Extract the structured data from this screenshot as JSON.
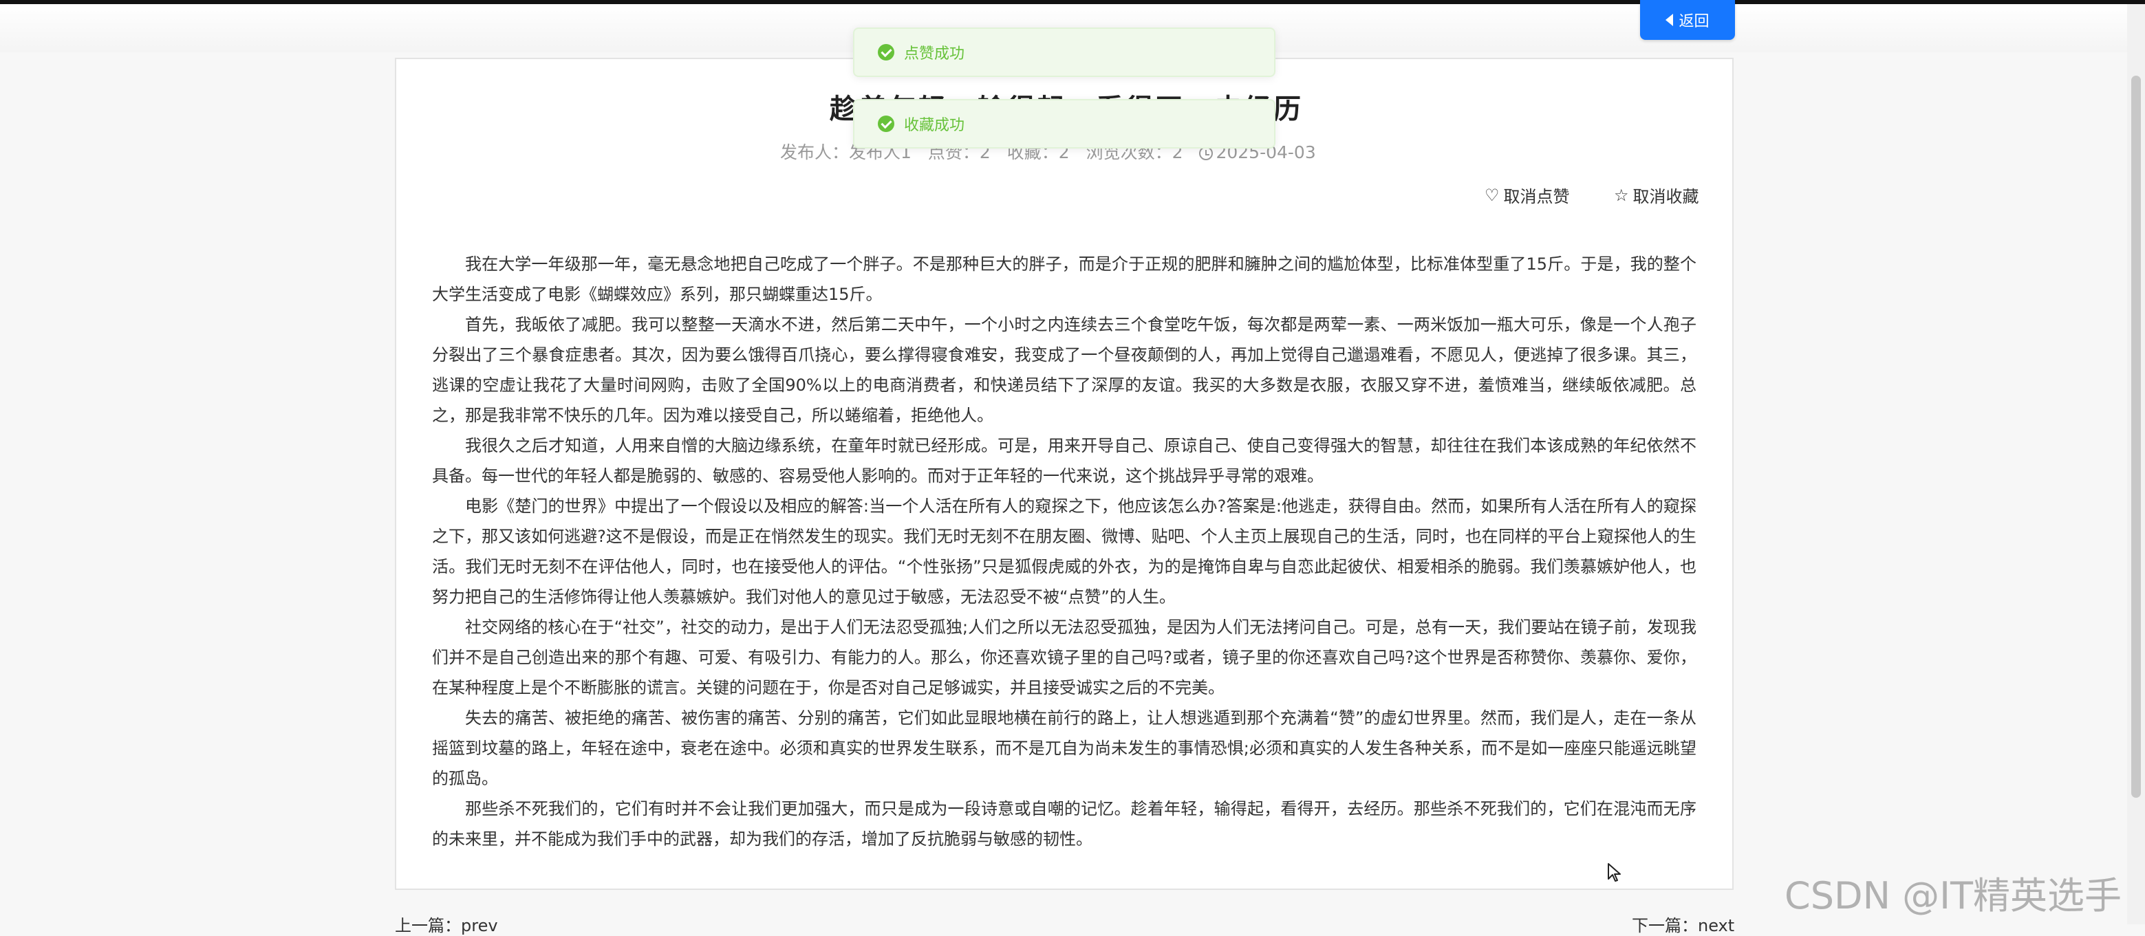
{
  "header": {
    "back_label": "返回"
  },
  "toasts": [
    {
      "text": "点赞成功"
    },
    {
      "text": "收藏成功"
    }
  ],
  "article": {
    "title": "趁着年轻，输得起，看得开，去经历",
    "meta": {
      "publisher": "发布人：发布人1",
      "likes": "点赞：2",
      "favorites": "收藏：2",
      "views": "浏览次数：2",
      "date": "2025-04-03"
    },
    "actions": {
      "unlike": "取消点赞",
      "unfavorite": "取消收藏"
    },
    "paragraphs": [
      "我在大学一年级那一年，毫无悬念地把自己吃成了一个胖子。不是那种巨大的胖子，而是介于正规的肥胖和臃肿之间的尴尬体型，比标准体型重了15斤。于是，我的整个大学生活变成了电影《蝴蝶效应》系列，那只蝴蝶重达15斤。",
      "首先，我皈依了减肥。我可以整整一天滴水不进，然后第二天中午，一个小时之内连续去三个食堂吃午饭，每次都是两荤一素、一两米饭加一瓶大可乐，像是一个人孢子分裂出了三个暴食症患者。其次，因为要么饿得百爪挠心，要么撑得寝食难安，我变成了一个昼夜颠倒的人，再加上觉得自己邋遢难看，不愿见人，便逃掉了很多课。其三，逃课的空虚让我花了大量时间网购，击败了全国90%以上的电商消费者，和快递员结下了深厚的友谊。我买的大多数是衣服，衣服又穿不进，羞愤难当，继续皈依减肥。总之，那是我非常不快乐的几年。因为难以接受自己，所以蜷缩着，拒绝他人。",
      "我很久之后才知道，人用来自憎的大脑边缘系统，在童年时就已经形成。可是，用来开导自己、原谅自己、使自己变得强大的智慧，却往往在我们本该成熟的年纪依然不具备。每一世代的年轻人都是脆弱的、敏感的、容易受他人影响的。而对于正年轻的一代来说，这个挑战异乎寻常的艰难。",
      "电影《楚门的世界》中提出了一个假设以及相应的解答:当一个人活在所有人的窥探之下，他应该怎么办?答案是:他逃走，获得自由。然而，如果所有人活在所有人的窥探之下，那又该如何逃避?这不是假设，而是正在悄然发生的现实。我们无时无刻不在朋友圈、微博、贴吧、个人主页上展现自己的生活，同时，也在同样的平台上窥探他人的生活。我们无时无刻不在评估他人，同时，也在接受他人的评估。“个性张扬”只是狐假虎威的外衣，为的是掩饰自卑与自恋此起彼伏、相爱相杀的脆弱。我们羡慕嫉妒他人，也努力把自己的生活修饰得让他人羡慕嫉妒。我们对他人的意见过于敏感，无法忍受不被“点赞”的人生。",
      "社交网络的核心在于“社交”，社交的动力，是出于人们无法忍受孤独;人们之所以无法忍受孤独，是因为人们无法拷问自己。可是，总有一天，我们要站在镜子前，发现我们并不是自己创造出来的那个有趣、可爱、有吸引力、有能力的人。那么，你还喜欢镜子里的自己吗?或者，镜子里的你还喜欢自己吗?这个世界是否称赞你、羡慕你、爱你，在某种程度上是个不断膨胀的谎言。关键的问题在于，你是否对自己足够诚实，并且接受诚实之后的不完美。",
      "失去的痛苦、被拒绝的痛苦、被伤害的痛苦、分别的痛苦，它们如此显眼地横在前行的路上，让人想逃遁到那个充满着“赞”的虚幻世界里。然而，我们是人，走在一条从摇篮到坟墓的路上，年轻在途中，衰老在途中。必须和真实的世界发生联系，而不是兀自为尚未发生的事情恐惧;必须和真实的人发生各种关系，而不是如一座座只能遥远眺望的孤岛。",
      "那些杀不死我们的，它们有时并不会让我们更加强大，而只是成为一段诗意或自嘲的记忆。趁着年轻，输得起，看得开，去经历。那些杀不死我们的，它们在混沌而无序的未来里，并不能成为我们手中的武器，却为我们的存活，增加了反抗脆弱与敏感的韧性。"
    ]
  },
  "nav": {
    "prev": "上一篇：prev",
    "next": "下一篇：next"
  },
  "watermark": "CSDN @IT精英选手",
  "colors": {
    "primary": "#1677ff",
    "success": "#67c23a",
    "success_bg": "#f0f9eb"
  }
}
